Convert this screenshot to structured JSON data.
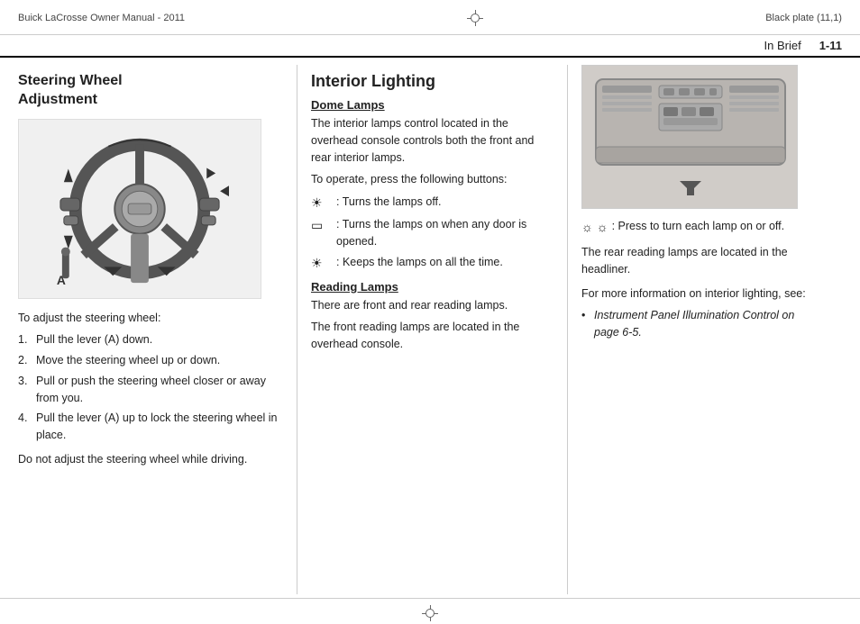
{
  "header": {
    "left": "Buick LaCrosse Owner Manual - 2011",
    "right": "Black plate (11,1)"
  },
  "page_number": {
    "label": "In Brief",
    "number": "1-11"
  },
  "steering_section": {
    "title_line1": "Steering Wheel",
    "title_line2": "Adjustment",
    "intro": "To adjust the steering wheel:",
    "steps": [
      "Pull the lever (A) down.",
      "Move the steering wheel up or down.",
      "Pull or push the steering wheel closer or away from you.",
      "Pull the lever (A) up to lock the steering wheel in place."
    ],
    "warning": "Do not adjust the steering wheel while driving."
  },
  "interior_lighting_section": {
    "title": "Interior Lighting",
    "dome_lamps": {
      "subtitle": "Dome Lamps",
      "intro": "The interior lamps control located in the overhead console controls both the front and rear interior lamps.",
      "operate_intro": "To operate, press the following buttons:",
      "icon1_symbol": "☀",
      "icon1_text": "Turns the lamps off.",
      "icon2_symbol": "▭",
      "icon2_text": "Turns the lamps on when any door is opened.",
      "icon3_symbol": "☀",
      "icon3_text": "Keeps the lamps on all the time."
    },
    "reading_lamps": {
      "subtitle": "Reading Lamps",
      "text1": "There are front and rear reading lamps.",
      "text2": "The front reading lamps are located in the overhead console."
    }
  },
  "right_section": {
    "icon_text": "Press to turn each lamp on or off.",
    "rear_text": "The rear reading lamps are located in the headliner.",
    "more_info": "For more information on interior lighting, see:",
    "bullet": "Instrument Panel Illumination Control on page 6-5."
  }
}
